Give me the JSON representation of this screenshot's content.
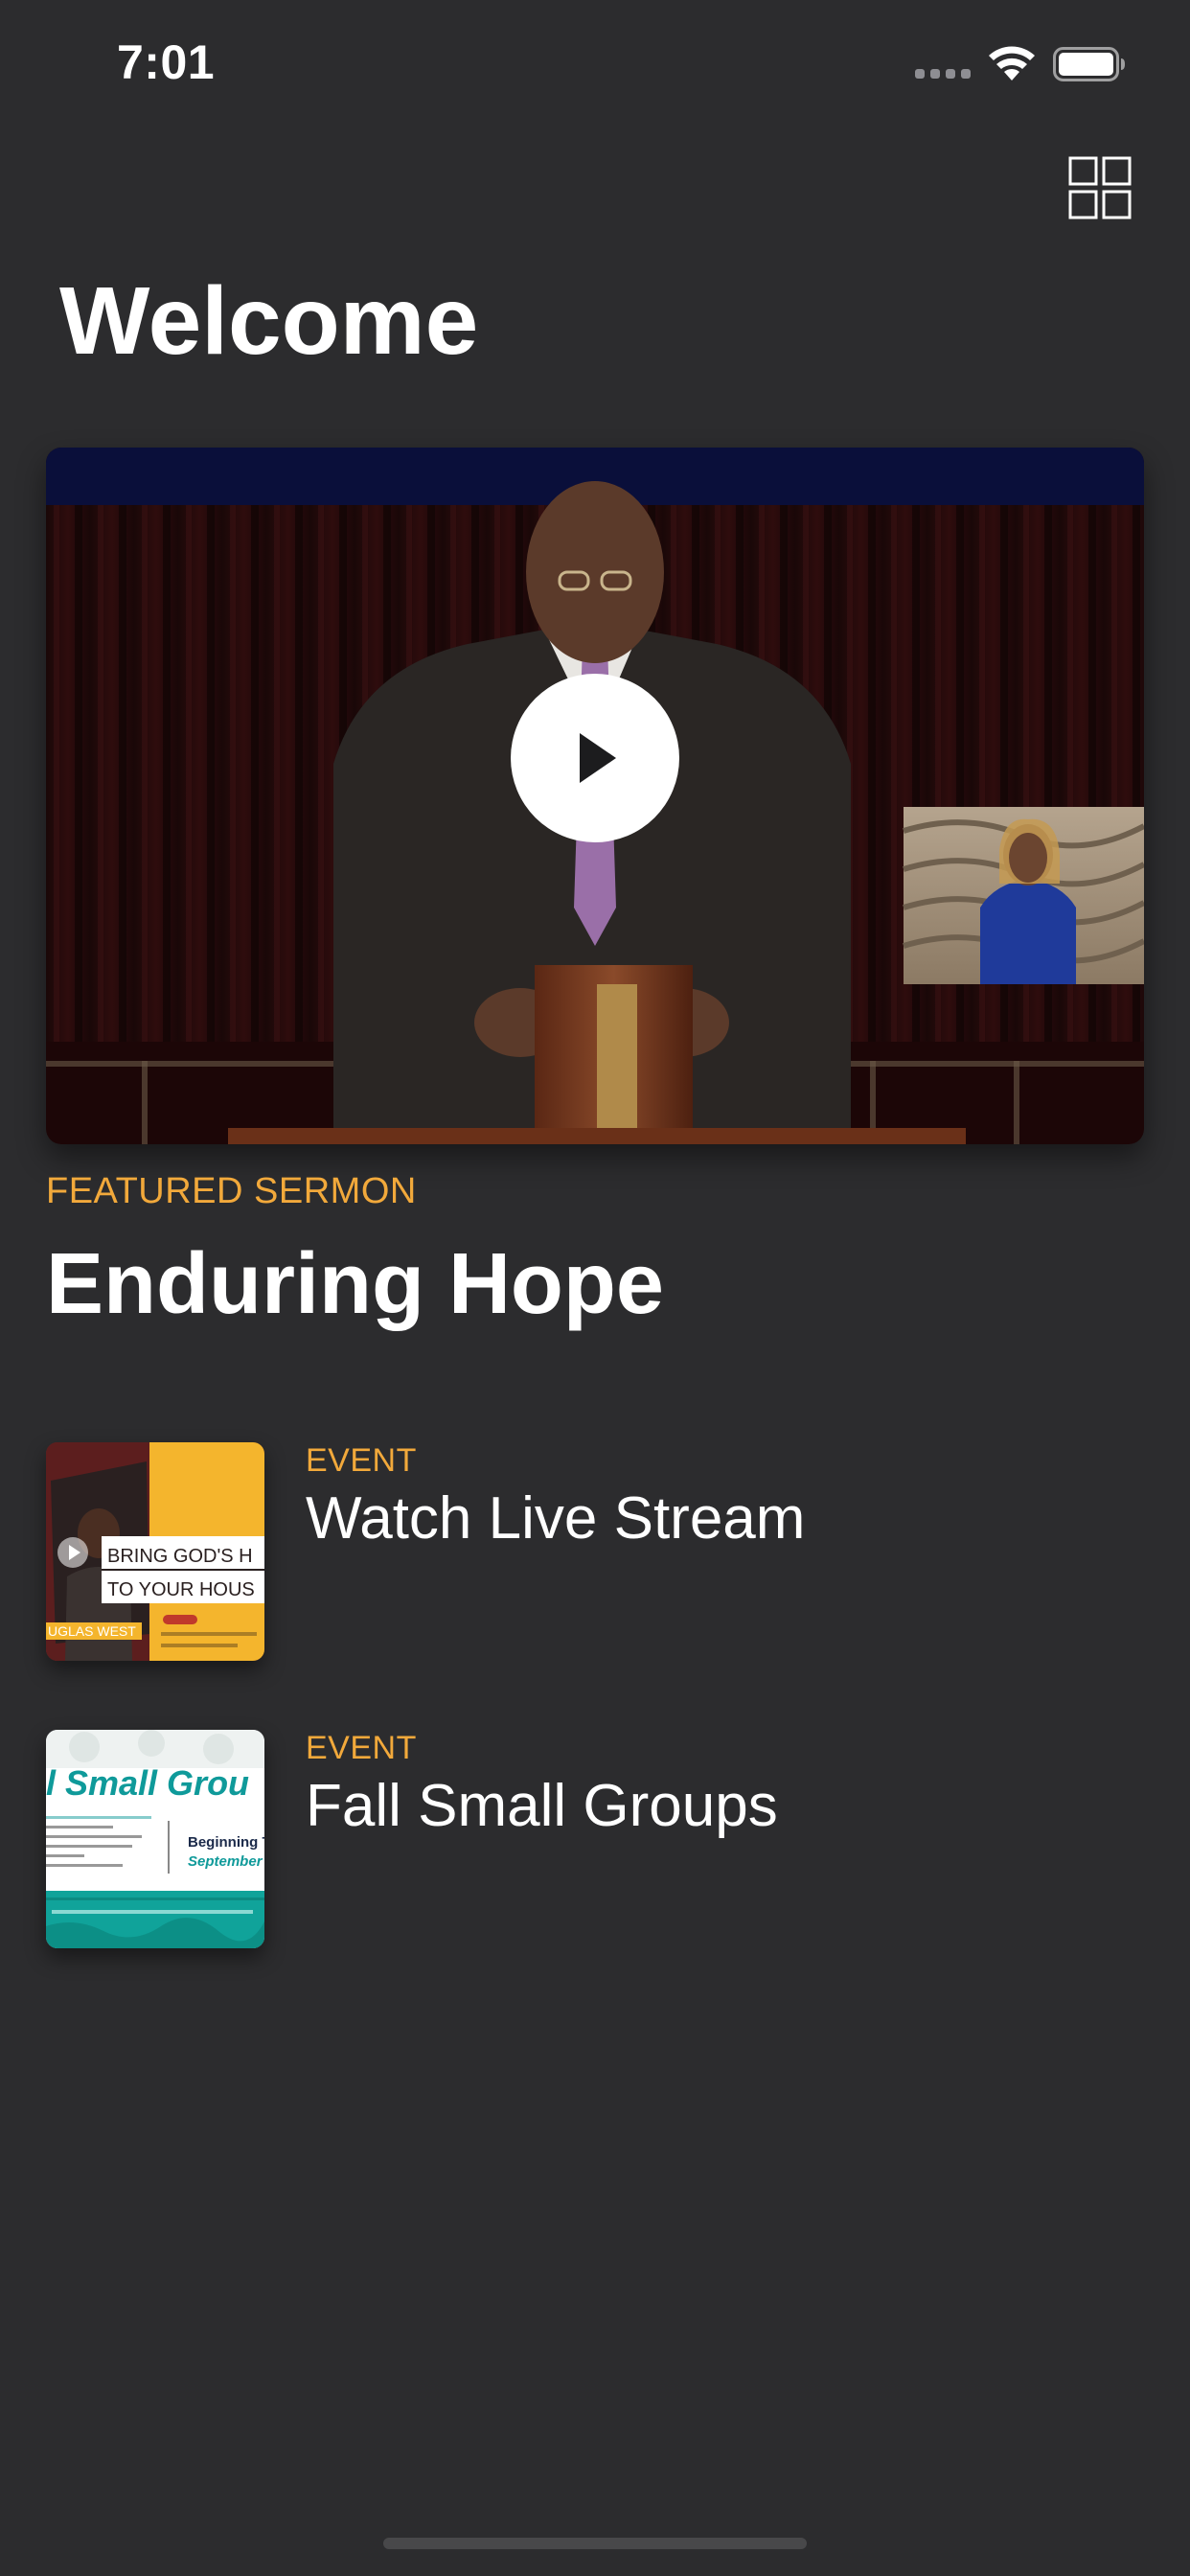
{
  "status_bar": {
    "time": "7:01",
    "wifi_icon": "wifi-icon",
    "battery_icon": "battery-icon"
  },
  "header": {
    "grid_icon": "grid-icon",
    "title": "Welcome"
  },
  "featured": {
    "label": "FEATURED SERMON",
    "title": "Enduring Hope",
    "play_icon": "play-icon"
  },
  "events": [
    {
      "label": "EVENT",
      "title": "Watch Live Stream",
      "thumb_text_1": "BRING GOD'S H",
      "thumb_text_2": "TO YOUR HOUS",
      "thumb_name": "UGLAS WEST"
    },
    {
      "label": "EVENT",
      "title": "Fall Small Groups",
      "thumb_text_1": "l Small Grou",
      "thumb_text_2": "Beginning T",
      "thumb_text_3": "September"
    }
  ],
  "colors": {
    "background": "#2c2c2e",
    "accent": "#f2a93b",
    "text": "#ffffff"
  }
}
